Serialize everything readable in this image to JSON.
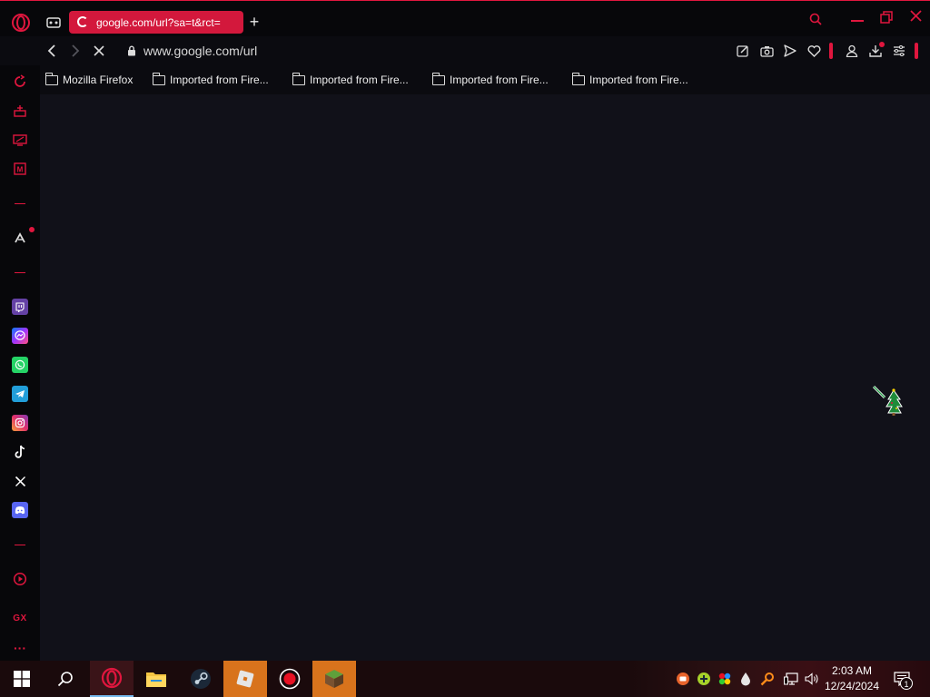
{
  "browser": {
    "tab": {
      "title": "google.com/url?sa=t&rct="
    },
    "new_tab_symbol": "+",
    "address": {
      "url": "www.google.com/url"
    },
    "bookmarks": [
      "Mozilla Firefox",
      "Imported from Fire...",
      "Imported from Fire...",
      "Imported from Fire...",
      "Imported from Fire..."
    ],
    "sidebar": {
      "gx_label": "GX",
      "more_label": "···"
    },
    "colors": {
      "accent": "#e0163e",
      "tab": "#d3183c",
      "content": "#111119"
    }
  },
  "taskbar": {
    "clock": {
      "time": "2:03 AM",
      "date": "12/24/2024"
    },
    "notification_count": "1"
  }
}
